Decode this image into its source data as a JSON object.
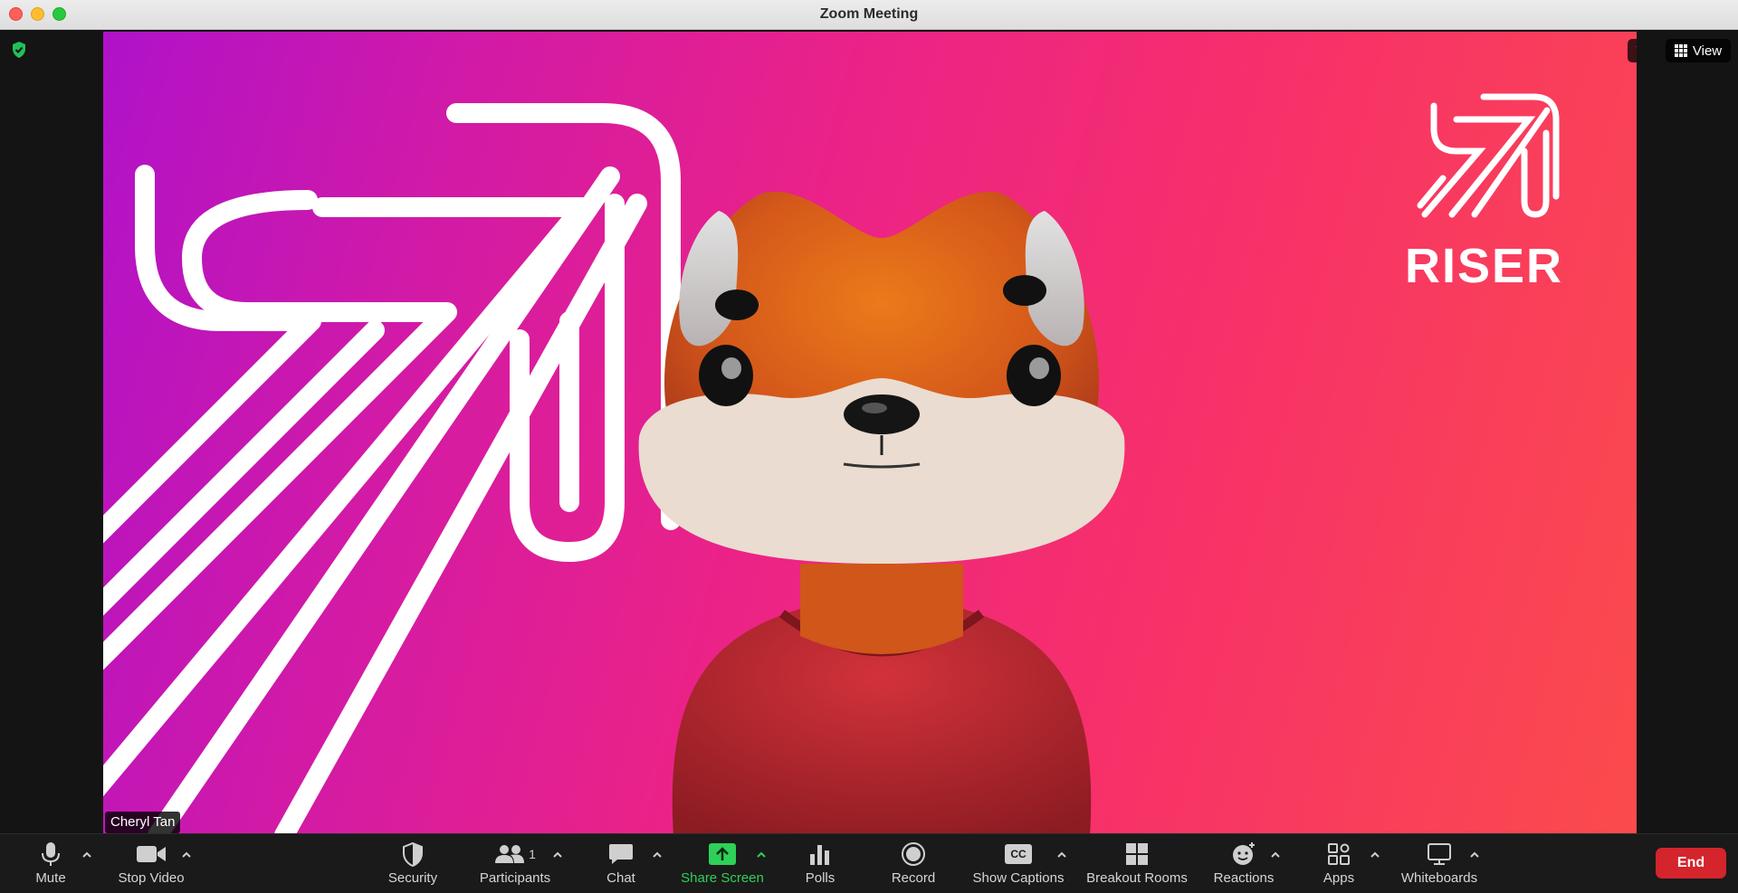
{
  "window": {
    "title": "Zoom Meeting"
  },
  "top_controls": {
    "view_label": "View"
  },
  "video": {
    "participant_name": "Cheryl Tan",
    "background_logo_text": "RISER"
  },
  "toolbar": {
    "mute_label": "Mute",
    "stop_video_label": "Stop Video",
    "security_label": "Security",
    "participants_label": "Participants",
    "participants_count": "1",
    "chat_label": "Chat",
    "share_screen_label": "Share Screen",
    "polls_label": "Polls",
    "record_label": "Record",
    "show_captions_label": "Show Captions",
    "captions_icon_text": "CC",
    "breakout_rooms_label": "Breakout Rooms",
    "reactions_label": "Reactions",
    "apps_label": "Apps",
    "whiteboards_label": "Whiteboards",
    "end_label": "End"
  },
  "colors": {
    "share_green": "#2ed058",
    "end_red": "#d4242c",
    "encryption_green": "#23c05a"
  }
}
